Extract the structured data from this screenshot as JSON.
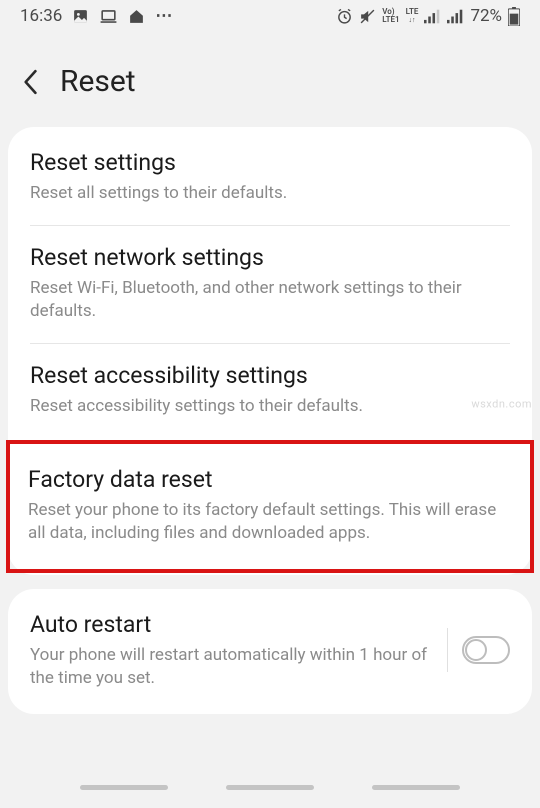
{
  "status": {
    "time": "16:36",
    "lte_label_top": "Vo)",
    "lte_label_bot": "LTE1",
    "net_label": "LTE",
    "battery_pct": "72%"
  },
  "header": {
    "title": "Reset"
  },
  "items": [
    {
      "title": "Reset settings",
      "desc": "Reset all settings to their defaults."
    },
    {
      "title": "Reset network settings",
      "desc": "Reset Wi-Fi, Bluetooth, and other network settings to their defaults."
    },
    {
      "title": "Reset accessibility settings",
      "desc": "Reset accessibility settings to their defaults."
    },
    {
      "title": "Factory data reset",
      "desc": "Reset your phone to its factory default settings. This will erase all data, including files and downloaded apps."
    }
  ],
  "auto_restart": {
    "title": "Auto restart",
    "desc": "Your phone will restart automatically within 1 hour of the time you set."
  },
  "watermark": "wsxdn.com"
}
